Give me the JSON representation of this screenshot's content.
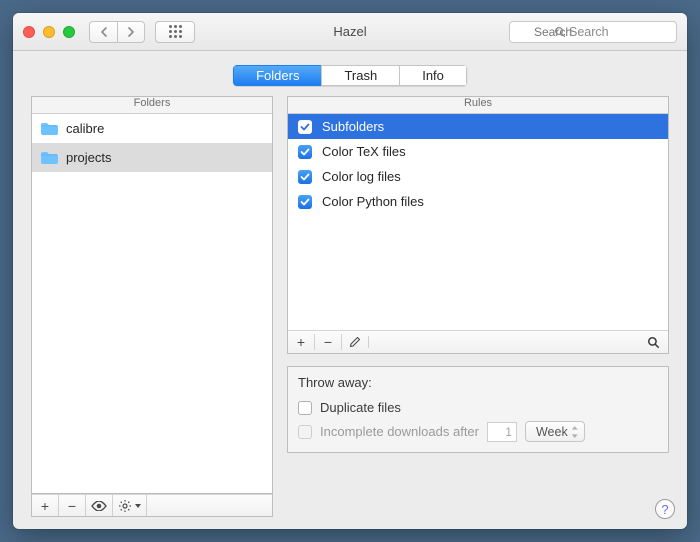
{
  "window": {
    "title": "Hazel"
  },
  "toolbar": {
    "search_placeholder": "Search"
  },
  "tabs": {
    "items": [
      {
        "label": "Folders",
        "active": true
      },
      {
        "label": "Trash",
        "active": false
      },
      {
        "label": "Info",
        "active": false
      }
    ]
  },
  "folders": {
    "header": "Folders",
    "items": [
      {
        "name": "calibre",
        "selected": false
      },
      {
        "name": "projects",
        "selected": true
      }
    ]
  },
  "rules": {
    "header": "Rules",
    "items": [
      {
        "name": "Subfolders",
        "checked": true,
        "selected": true
      },
      {
        "name": "Color TeX files",
        "checked": true,
        "selected": false
      },
      {
        "name": "Color log files",
        "checked": true,
        "selected": false
      },
      {
        "name": "Color Python files",
        "checked": true,
        "selected": false
      }
    ]
  },
  "throw_away": {
    "title": "Throw away:",
    "duplicate_label": "Duplicate files",
    "duplicate_checked": false,
    "incomplete_label": "Incomplete downloads after",
    "incomplete_checked": false,
    "incomplete_enabled": false,
    "incomplete_value": "1",
    "incomplete_unit": "Week"
  },
  "help": {
    "label": "?"
  }
}
